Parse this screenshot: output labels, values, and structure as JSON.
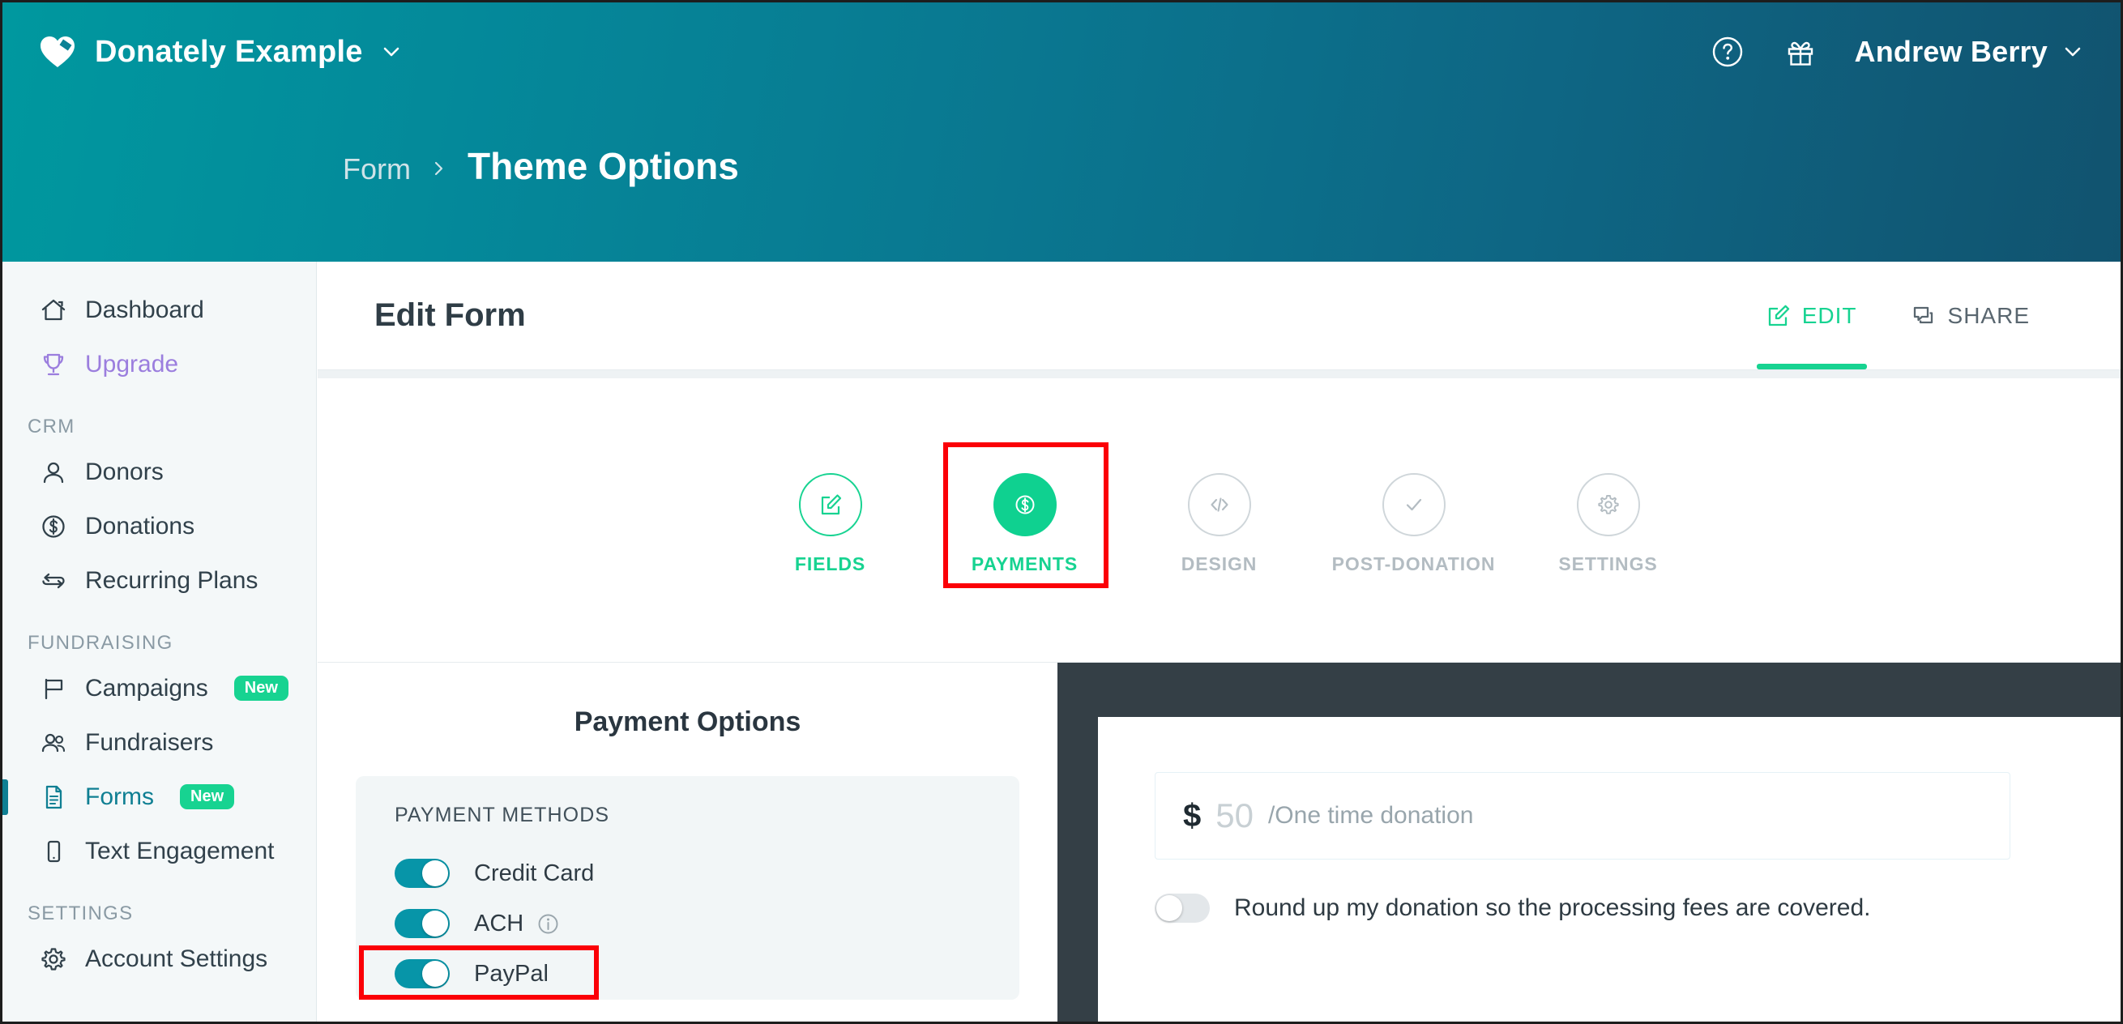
{
  "header": {
    "logo_icon": "heart-tag-logo",
    "org_name": "Donately Example",
    "org_chevron_icon": "chevron-down-icon",
    "help_icon": "help-circle-icon",
    "gift_icon": "gift-icon",
    "user_name": "Andrew Berry",
    "user_chevron_icon": "chevron-down-icon"
  },
  "breadcrumb": {
    "parent": "Form",
    "separator_icon": "chevron-right-icon",
    "current": "Theme Options"
  },
  "sidebar": {
    "items": [
      {
        "label": "Dashboard",
        "icon": "home-icon",
        "state": "default"
      },
      {
        "label": "Upgrade",
        "icon": "trophy-icon",
        "state": "upgrade"
      }
    ],
    "sections": [
      {
        "title": "CRM",
        "items": [
          {
            "label": "Donors",
            "icon": "user-icon",
            "state": "default"
          },
          {
            "label": "Donations",
            "icon": "dollar-circle-icon",
            "state": "default"
          },
          {
            "label": "Recurring Plans",
            "icon": "recurring-icon",
            "state": "default"
          }
        ]
      },
      {
        "title": "FUNDRAISING",
        "items": [
          {
            "label": "Campaigns",
            "icon": "flag-icon",
            "state": "default",
            "badge": "New"
          },
          {
            "label": "Fundraisers",
            "icon": "users-icon",
            "state": "default"
          },
          {
            "label": "Forms",
            "icon": "document-icon",
            "state": "active",
            "badge": "New"
          },
          {
            "label": "Text Engagement",
            "icon": "mobile-icon",
            "state": "default"
          }
        ]
      },
      {
        "title": "SETTINGS",
        "items": [
          {
            "label": "Account Settings",
            "icon": "gear-icon",
            "state": "default"
          }
        ]
      }
    ]
  },
  "form_editor": {
    "title": "Edit Form",
    "tabs": [
      {
        "label": "EDIT",
        "icon": "edit-square-icon",
        "active": true
      },
      {
        "label": "SHARE",
        "icon": "share-chat-icon",
        "active": false
      }
    ],
    "steps": [
      {
        "label": "FIELDS",
        "icon": "pencil-square-icon",
        "state": "done"
      },
      {
        "label": "PAYMENTS",
        "icon": "dollar-circle-icon",
        "state": "current",
        "highlighted": true
      },
      {
        "label": "DESIGN",
        "icon": "code-icon",
        "state": "pending"
      },
      {
        "label": "POST-DONATION",
        "icon": "check-icon",
        "state": "pending"
      },
      {
        "label": "SETTINGS",
        "icon": "gear-icon",
        "state": "pending"
      }
    ]
  },
  "payment_options": {
    "title": "Payment Options",
    "methods_header": "PAYMENT METHODS",
    "methods": [
      {
        "label": "Credit Card",
        "enabled": true,
        "info": false,
        "highlighted": false
      },
      {
        "label": "ACH",
        "enabled": true,
        "info": true,
        "info_icon": "info-circle-icon",
        "highlighted": false
      },
      {
        "label": "PayPal",
        "enabled": true,
        "info": false,
        "highlighted": true
      }
    ]
  },
  "preview": {
    "currency_symbol": "$",
    "amount_placeholder": "50",
    "frequency_note": "/One time donation",
    "roundup_label": "Round up my donation so the processing fees are covered.",
    "roundup_enabled": false
  },
  "colors": {
    "header_gradient_start": "#00989f",
    "header_gradient_end": "#11536f",
    "accent_green": "#17d391",
    "accent_teal": "#0795a8",
    "upgrade_purple": "#9b7ede",
    "highlight_red": "#fb0007",
    "preview_dark": "#343f46"
  }
}
